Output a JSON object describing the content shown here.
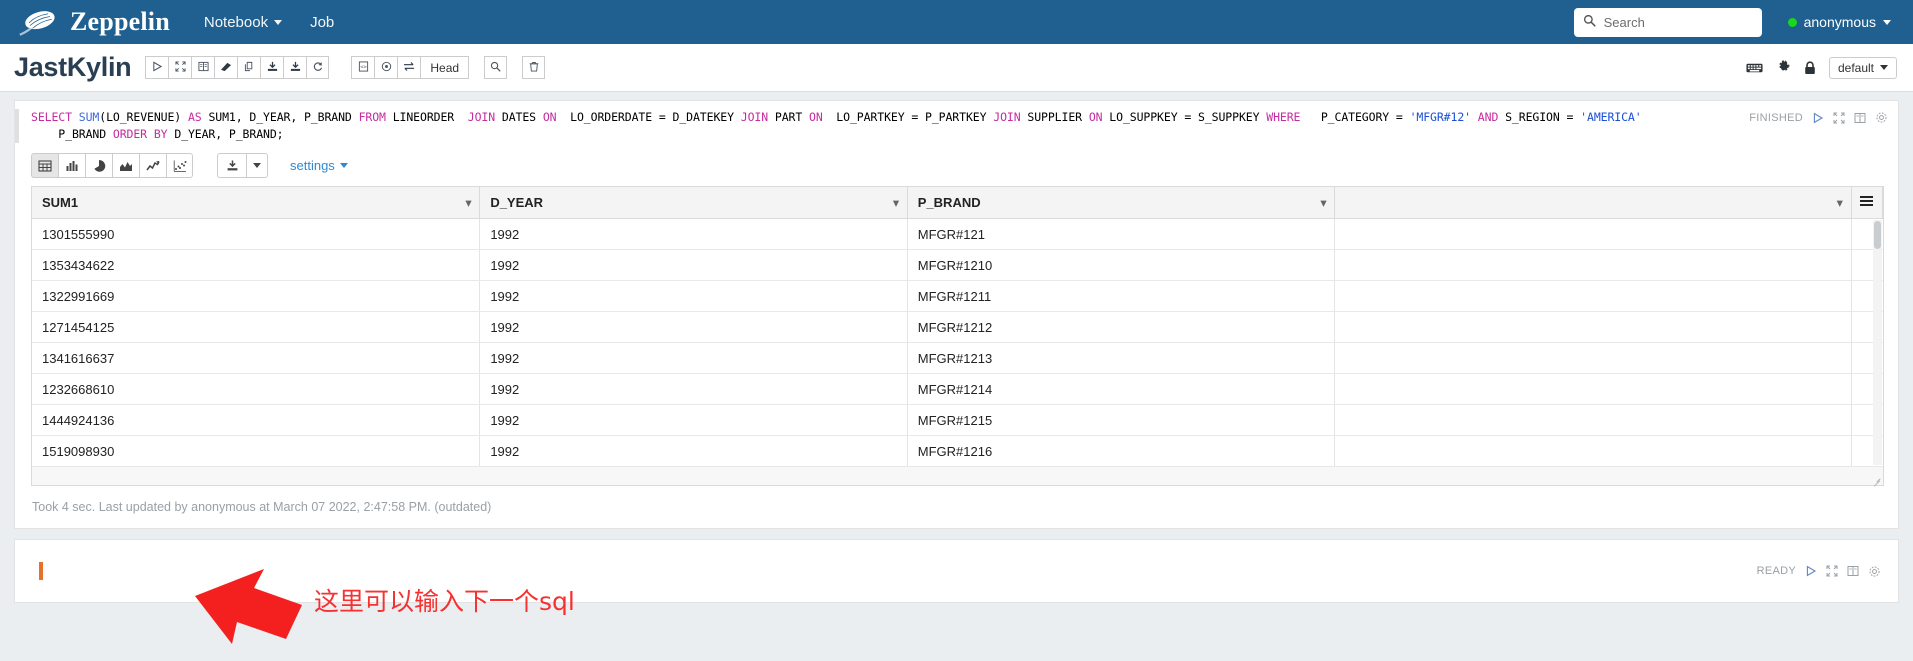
{
  "navbar": {
    "brand": "Zeppelin",
    "logo_icon": "zeppelin-airship-icon",
    "links": [
      {
        "label": "Notebook",
        "has_caret": true
      },
      {
        "label": "Job",
        "has_caret": false
      }
    ],
    "search": {
      "placeholder": "Search",
      "value": "",
      "icon": "search-icon"
    },
    "user": {
      "name": "anonymous",
      "status_color": "#19d719",
      "has_caret": true
    },
    "bg_color": "#1f6090"
  },
  "notebook": {
    "title": "JastKylin",
    "toolbar_group_1": [
      {
        "icon": "run-all-paragraphs-icon",
        "glyph": "play"
      },
      {
        "icon": "hide-all-output-icon",
        "glyph": "compress"
      },
      {
        "icon": "show-all-code-icon",
        "glyph": "book"
      },
      {
        "icon": "clear-all-output-icon",
        "glyph": "eraser"
      },
      {
        "icon": "clone-notebook-icon",
        "glyph": "copy"
      },
      {
        "icon": "export-notebook-icon",
        "glyph": "download"
      },
      {
        "icon": "import-notebook-icon",
        "glyph": "download2"
      },
      {
        "icon": "reload-notebook-icon",
        "glyph": "refresh"
      }
    ],
    "toolbar_group_2": [
      {
        "icon": "code-view-icon",
        "glyph": "code-file"
      },
      {
        "icon": "simple-view-icon",
        "glyph": "target"
      },
      {
        "icon": "report-view-icon",
        "glyph": "exchange"
      }
    ],
    "version_label": "Head",
    "toolbar_group_3": [
      {
        "icon": "find-replace-icon",
        "glyph": "search"
      }
    ],
    "toolbar_group_4": [
      {
        "icon": "delete-notebook-icon",
        "glyph": "trash"
      }
    ],
    "right_icons": [
      {
        "icon": "keyboard-shortcuts-icon",
        "glyph": "keyboard"
      },
      {
        "icon": "interpreter-binding-icon",
        "glyph": "gear"
      },
      {
        "icon": "permissions-lock-icon",
        "glyph": "lock"
      }
    ],
    "interpreter_select": {
      "label": "default",
      "has_caret": true
    }
  },
  "paragraph": {
    "code_line1_tokens": [
      {
        "t": "SELECT ",
        "c": "kw"
      },
      {
        "t": "SUM",
        "c": "fn"
      },
      {
        "t": "(LO_REVENUE) ",
        "c": ""
      },
      {
        "t": "AS ",
        "c": "kw"
      },
      {
        "t": "SUM1, D_YEAR, P_BRAND ",
        "c": ""
      },
      {
        "t": "FROM ",
        "c": "kw"
      },
      {
        "t": "LINEORDER  ",
        "c": ""
      },
      {
        "t": "JOIN ",
        "c": "kw"
      },
      {
        "t": "DATES ",
        "c": ""
      },
      {
        "t": "ON ",
        "c": "kw"
      },
      {
        "t": " LO_ORDERDATE = D_DATEKEY ",
        "c": ""
      },
      {
        "t": "JOIN ",
        "c": "kw"
      },
      {
        "t": "PART ",
        "c": ""
      },
      {
        "t": "ON ",
        "c": "kw"
      },
      {
        "t": " LO_PARTKEY = P_PARTKEY ",
        "c": ""
      },
      {
        "t": "JOIN ",
        "c": "kw"
      },
      {
        "t": "SUPPLIER ",
        "c": ""
      },
      {
        "t": "ON ",
        "c": "kw"
      },
      {
        "t": "LO_SUPPKEY = S_SUPPKEY ",
        "c": ""
      },
      {
        "t": "WHERE ",
        "c": "kw"
      },
      {
        "t": "  P_CATEGORY = ",
        "c": ""
      },
      {
        "t": "'MFGR#12'",
        "c": "str"
      },
      {
        "t": " AND ",
        "c": "kw"
      },
      {
        "t": "S_REGION = ",
        "c": ""
      },
      {
        "t": "'AMERICA'",
        "c": "str"
      }
    ],
    "code_line2_tokens": [
      {
        "t": "    P_BRAND ",
        "c": ""
      },
      {
        "t": "ORDER BY ",
        "c": "kw"
      },
      {
        "t": "D_YEAR, P_BRAND;",
        "c": ""
      }
    ],
    "code_plain": "SELECT SUM(LO_REVENUE) AS SUM1, D_YEAR, P_BRAND FROM LINEORDER  JOIN DATES ON  LO_ORDERDATE = D_DATEKEY JOIN PART ON  LO_PARTKEY = P_PARTKEY JOIN SUPPLIER ON LO_SUPPKEY = S_SUPPKEY WHERE   P_CATEGORY = 'MFGR#12' AND S_REGION = 'AMERICA'\n    P_BRAND ORDER BY D_YEAR, P_BRAND;",
    "status": "FINISHED",
    "status_icons": [
      {
        "icon": "run-paragraph-icon",
        "glyph": "play"
      },
      {
        "icon": "hide-output-icon",
        "glyph": "compress"
      },
      {
        "icon": "show-editor-icon",
        "glyph": "book"
      },
      {
        "icon": "paragraph-settings-icon",
        "glyph": "gear"
      }
    ],
    "viz_buttons": [
      {
        "icon": "table-chart-icon",
        "glyph": "table",
        "active": true
      },
      {
        "icon": "bar-chart-icon",
        "glyph": "bar",
        "active": false
      },
      {
        "icon": "pie-chart-icon",
        "glyph": "pie",
        "active": false
      },
      {
        "icon": "area-chart-icon",
        "glyph": "area",
        "active": false
      },
      {
        "icon": "line-chart-icon",
        "glyph": "line",
        "active": false
      },
      {
        "icon": "scatter-chart-icon",
        "glyph": "scatter",
        "active": false
      }
    ],
    "download_button": {
      "icon": "download-results-icon",
      "glyph": "download"
    },
    "download_caret": {
      "icon": "chevron-down-icon"
    },
    "settings_label": "settings",
    "took_text": "Took 4 sec. Last updated by anonymous at March 07 2022, 2:47:58 PM. (outdated)"
  },
  "table": {
    "columns": [
      "SUM1",
      "D_YEAR",
      "P_BRAND",
      ""
    ],
    "menu_icon": "table-menu-icon",
    "rows": [
      [
        "1301555990",
        "1992",
        "MFGR#121",
        ""
      ],
      [
        "1353434622",
        "1992",
        "MFGR#1210",
        ""
      ],
      [
        "1322991669",
        "1992",
        "MFGR#1211",
        ""
      ],
      [
        "1271454125",
        "1992",
        "MFGR#1212",
        ""
      ],
      [
        "1341616637",
        "1992",
        "MFGR#1213",
        ""
      ],
      [
        "1232668610",
        "1992",
        "MFGR#1214",
        ""
      ],
      [
        "1444924136",
        "1992",
        "MFGR#1215",
        ""
      ],
      [
        "1519098930",
        "1992",
        "MFGR#1216",
        ""
      ]
    ]
  },
  "new_paragraph": {
    "status": "READY",
    "cursor_color": "#e8702a",
    "status_icons": [
      {
        "icon": "run-paragraph-icon",
        "glyph": "play"
      },
      {
        "icon": "hide-output-icon",
        "glyph": "compress"
      },
      {
        "icon": "show-editor-icon",
        "glyph": "book"
      },
      {
        "icon": "paragraph-settings-icon",
        "glyph": "gear"
      }
    ]
  },
  "annotation": {
    "text": "这里可以输入下一个sql",
    "color": "#f73030",
    "arrow_icon": "red-arrow-pointing-left-icon"
  }
}
